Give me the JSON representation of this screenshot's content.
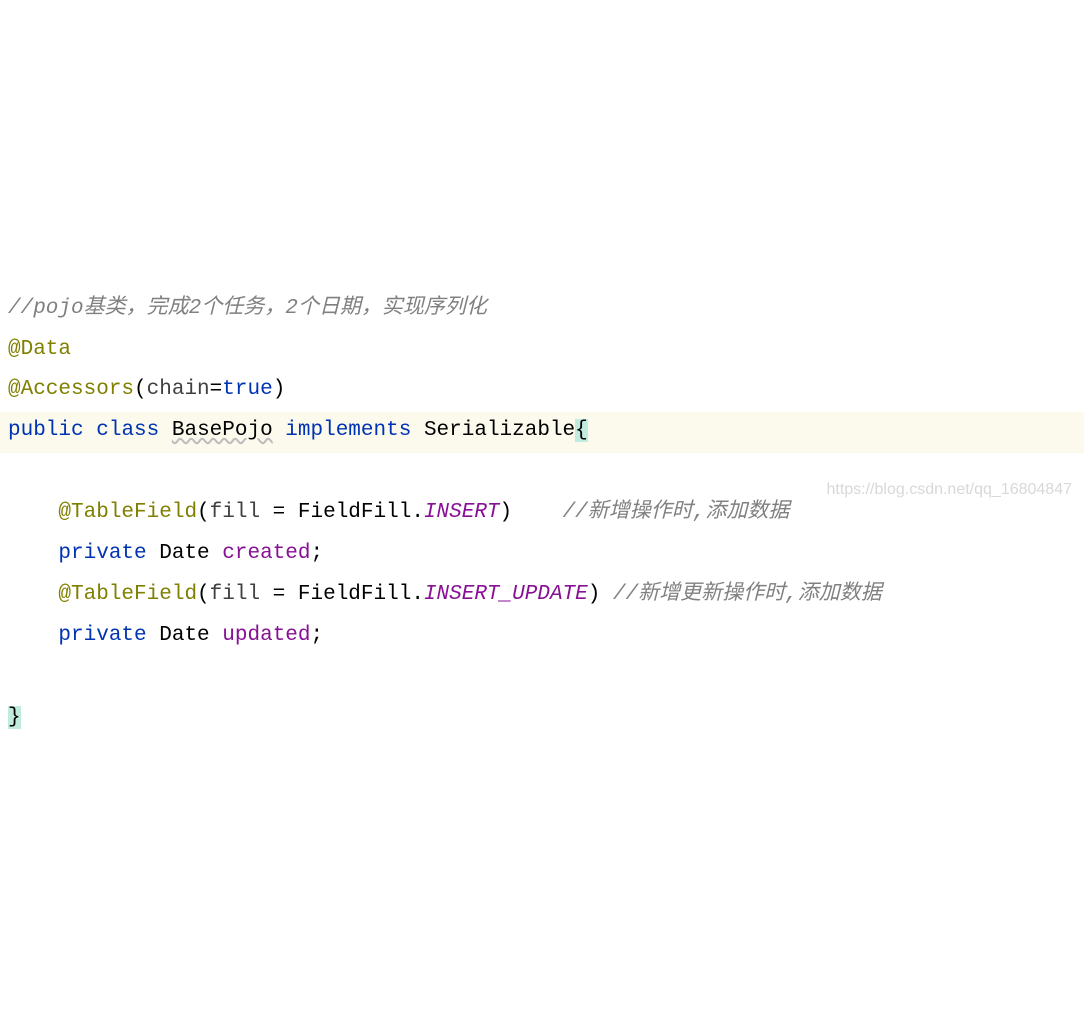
{
  "code": {
    "line1_comment": "//pojo基类，完成2个任务，2个日期，实现序列化",
    "line2_anno": "@Data",
    "line3_anno": "@Accessors",
    "line3_param": "chain",
    "line3_eq": "=",
    "line3_val": "true",
    "line4_public": "public",
    "line4_class": "class",
    "line4_name": "BasePojo",
    "line4_implements": "implements",
    "line4_iface": "Serializable",
    "line6_anno": "@TableField",
    "line6_param": "fill",
    "line6_eq": " = ",
    "line6_type": "FieldFill",
    "line6_dot": ".",
    "line6_val": "INSERT",
    "line6_comment": "//新增操作时,添加数据",
    "line7_private": "private",
    "line7_type": "Date",
    "line7_var": "created",
    "line7_semi": ";",
    "line8_anno": "@TableField",
    "line8_param": "fill",
    "line8_eq": " = ",
    "line8_type": "FieldFill",
    "line8_dot": ".",
    "line8_val": "INSERT_UPDATE",
    "line8_comment": "//新增更新操作时,添加数据",
    "line9_private": "private",
    "line9_type": "Date",
    "line9_var": "updated",
    "line9_semi": ";",
    "line11_brace": "}"
  },
  "watermark": "https://blog.csdn.net/qq_16804847"
}
